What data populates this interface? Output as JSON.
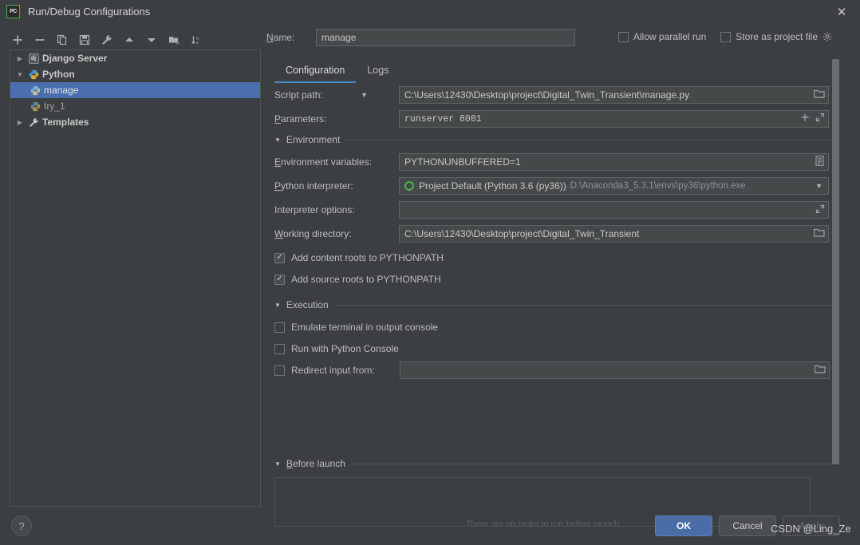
{
  "window": {
    "title": "Run/Debug Configurations",
    "app_icon": "PC",
    "close_icon": "close-icon"
  },
  "toolbar": {
    "buttons": [
      {
        "name": "add-configuration",
        "icon": "plus-icon"
      },
      {
        "name": "remove-configuration",
        "icon": "minus-icon"
      },
      {
        "name": "copy-configuration",
        "icon": "copy-icon"
      },
      {
        "name": "save-configuration",
        "icon": "save-icon"
      },
      {
        "name": "edit-templates",
        "icon": "wrench-icon"
      },
      {
        "name": "move-up",
        "icon": "arrow-up-icon"
      },
      {
        "name": "move-down",
        "icon": "arrow-down-icon"
      },
      {
        "name": "new-folder",
        "icon": "folder-add-icon"
      },
      {
        "name": "sort-alphabetically",
        "icon": "sort-az-icon"
      }
    ]
  },
  "tree": {
    "items": [
      {
        "label": "Django Server",
        "icon": "django-icon",
        "twisty": "collapsed",
        "level": 0,
        "bold": true,
        "selected": false
      },
      {
        "label": "Python",
        "icon": "python-icon",
        "twisty": "expanded",
        "level": 0,
        "bold": true,
        "selected": false
      },
      {
        "label": "manage",
        "icon": "python-icon",
        "twisty": "none",
        "level": 1,
        "bold": false,
        "selected": true
      },
      {
        "label": "try_1",
        "icon": "python-icon",
        "twisty": "none",
        "level": 1,
        "bold": false,
        "selected": false
      },
      {
        "label": "Templates",
        "icon": "wrench-icon",
        "twisty": "collapsed",
        "level": 0,
        "bold": true,
        "selected": false
      }
    ]
  },
  "form": {
    "name_label": "Name:",
    "name_value": "manage",
    "allow_parallel_run": {
      "label": "Allow parallel run",
      "checked": false
    },
    "store_as_project_file": {
      "label": "Store as project file",
      "checked": false,
      "gear_icon": "gear-icon"
    },
    "tabs": [
      {
        "label": "Configuration",
        "active": true
      },
      {
        "label": "Logs",
        "active": false
      }
    ],
    "script_path": {
      "label": "Script path:",
      "value": "C:\\Users\\12430\\Desktop\\project\\Digital_Twin_Transient\\manage.py",
      "browse_icon": "folder-icon",
      "caret_icon": "chevron-down-icon"
    },
    "parameters": {
      "label": "Parameters:",
      "value": "runserver 8001",
      "insert_icon": "plus-icon",
      "expand_icon": "expand-icon"
    },
    "environment_section": "Environment",
    "environment_variables": {
      "label": "Environment variables:",
      "value": "PYTHONUNBUFFERED=1",
      "edit_icon": "list-icon"
    },
    "python_interpreter": {
      "label": "Python interpreter:",
      "value": "Project Default (Python 3.6 (py36))",
      "path": "D:\\Anaconda3_5.3.1\\envs\\py36\\python.exe",
      "status_icon": "green-circle-icon",
      "caret_icon": "chevron-down-icon"
    },
    "interpreter_options": {
      "label": "Interpreter options:",
      "value": "",
      "expand_icon": "expand-icon"
    },
    "working_directory": {
      "label": "Working directory:",
      "value": "C:\\Users\\12430\\Desktop\\project\\Digital_Twin_Transient",
      "browse_icon": "folder-icon"
    },
    "add_content_roots": {
      "label": "Add content roots to PYTHONPATH",
      "checked": true
    },
    "add_source_roots": {
      "label": "Add source roots to PYTHONPATH",
      "checked": true
    },
    "execution_section": "Execution",
    "emulate_terminal": {
      "label": "Emulate terminal in output console",
      "checked": false
    },
    "run_with_python_console": {
      "label": "Run with Python Console",
      "checked": false
    },
    "redirect_input": {
      "label": "Redirect input from:",
      "checked": false,
      "value": "",
      "browse_icon": "folder-icon"
    },
    "before_launch_section": "Before launch",
    "before_launch_add_icon": "plus-icon",
    "before_launch_remove_icon": "minus-icon"
  },
  "footer": {
    "ok_label": "OK",
    "cancel_label": "Cancel",
    "apply_label": "Apply",
    "help_icon": "question-mark-icon"
  },
  "watermark": "CSDN @Ling_Ze",
  "colors": {
    "background": "#3c3f41",
    "field_background": "#45494a",
    "selection_blue": "#4b6eaf",
    "accent_tab": "#4a88c7",
    "ok_button": "#4a6da7",
    "green_status": "#4fae4f"
  }
}
